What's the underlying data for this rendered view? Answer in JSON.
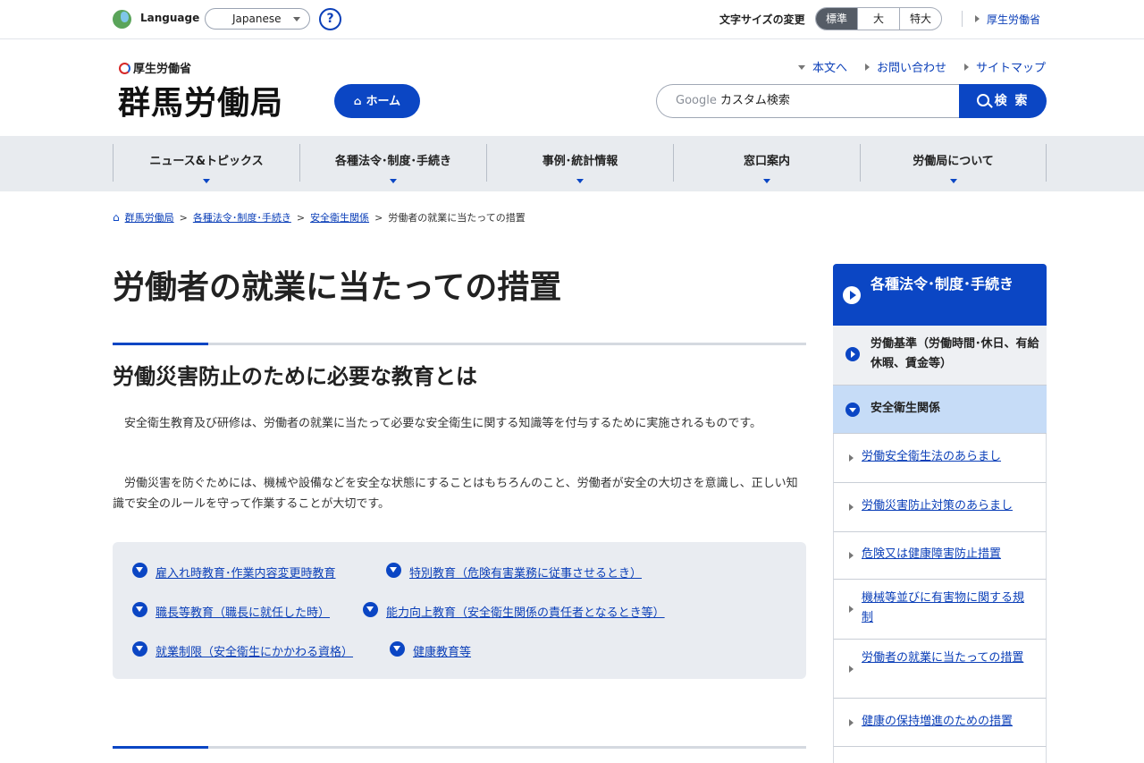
{
  "util": {
    "language_label": "Language",
    "language_value": "Japanese",
    "help": "?",
    "fontsize_label": "文字サイズの変更",
    "fontsize_options": [
      "標準",
      "大",
      "特大"
    ],
    "mhlw_link": "厚生労働省"
  },
  "header": {
    "logo_sub": "厚生労働省",
    "logo_main": "群馬労働局",
    "home": "ホーム",
    "links": [
      "本文へ",
      "お問い合わせ",
      "サイトマップ"
    ],
    "search_google": "Google",
    "search_placeholder": "カスタム検索",
    "search_button": "検 索"
  },
  "gnav": [
    "ニュース&トピックス",
    "各種法令･制度･手続き",
    "事例･統計情報",
    "窓口案内",
    "労働局について"
  ],
  "breadcrumb": [
    "群馬労働局",
    "各種法令･制度･手続き",
    "安全衛生関係",
    "労働者の就業に当たっての措置"
  ],
  "main": {
    "title": "労働者の就業に当たっての措置",
    "section_title": "労働災害防止のために必要な教育とは",
    "para1": "安全衛生教育及び研修は、労働者の就業に当たって必要な安全衛生に関する知識等を付与するために実施されるものです。",
    "para2": "労働災害を防ぐためには、機械や設備などを安全な状態にすることはもちろんのこと、労働者が安全の大切さを意識し、正しい知識で安全のルールを守って作業することが大切です。",
    "links": [
      "雇入れ時教育･作業内容変更時教育",
      "特別教育（危険有害業務に従事させるとき）",
      "職長等教育（職長に就任した時）",
      "能力向上教育（安全衛生関係の責任者となるとき等）",
      "就業制限（安全衛生にかかわる資格）",
      "健康教育等"
    ]
  },
  "sidebar": {
    "head": "各種法令･制度･手続き",
    "cat1": "労働基準（労働時間･休日、有給休暇、賃金等）",
    "cat2": "安全衛生関係",
    "subs": [
      "労働安全衛生法のあらまし",
      "労働災害防止対策のあらまし",
      "危険又は健康障害防止措置",
      "機械等並びに有害物に関する規制",
      "労働者の就業に当たっての措置",
      "健康の保持増進のための措置"
    ]
  }
}
